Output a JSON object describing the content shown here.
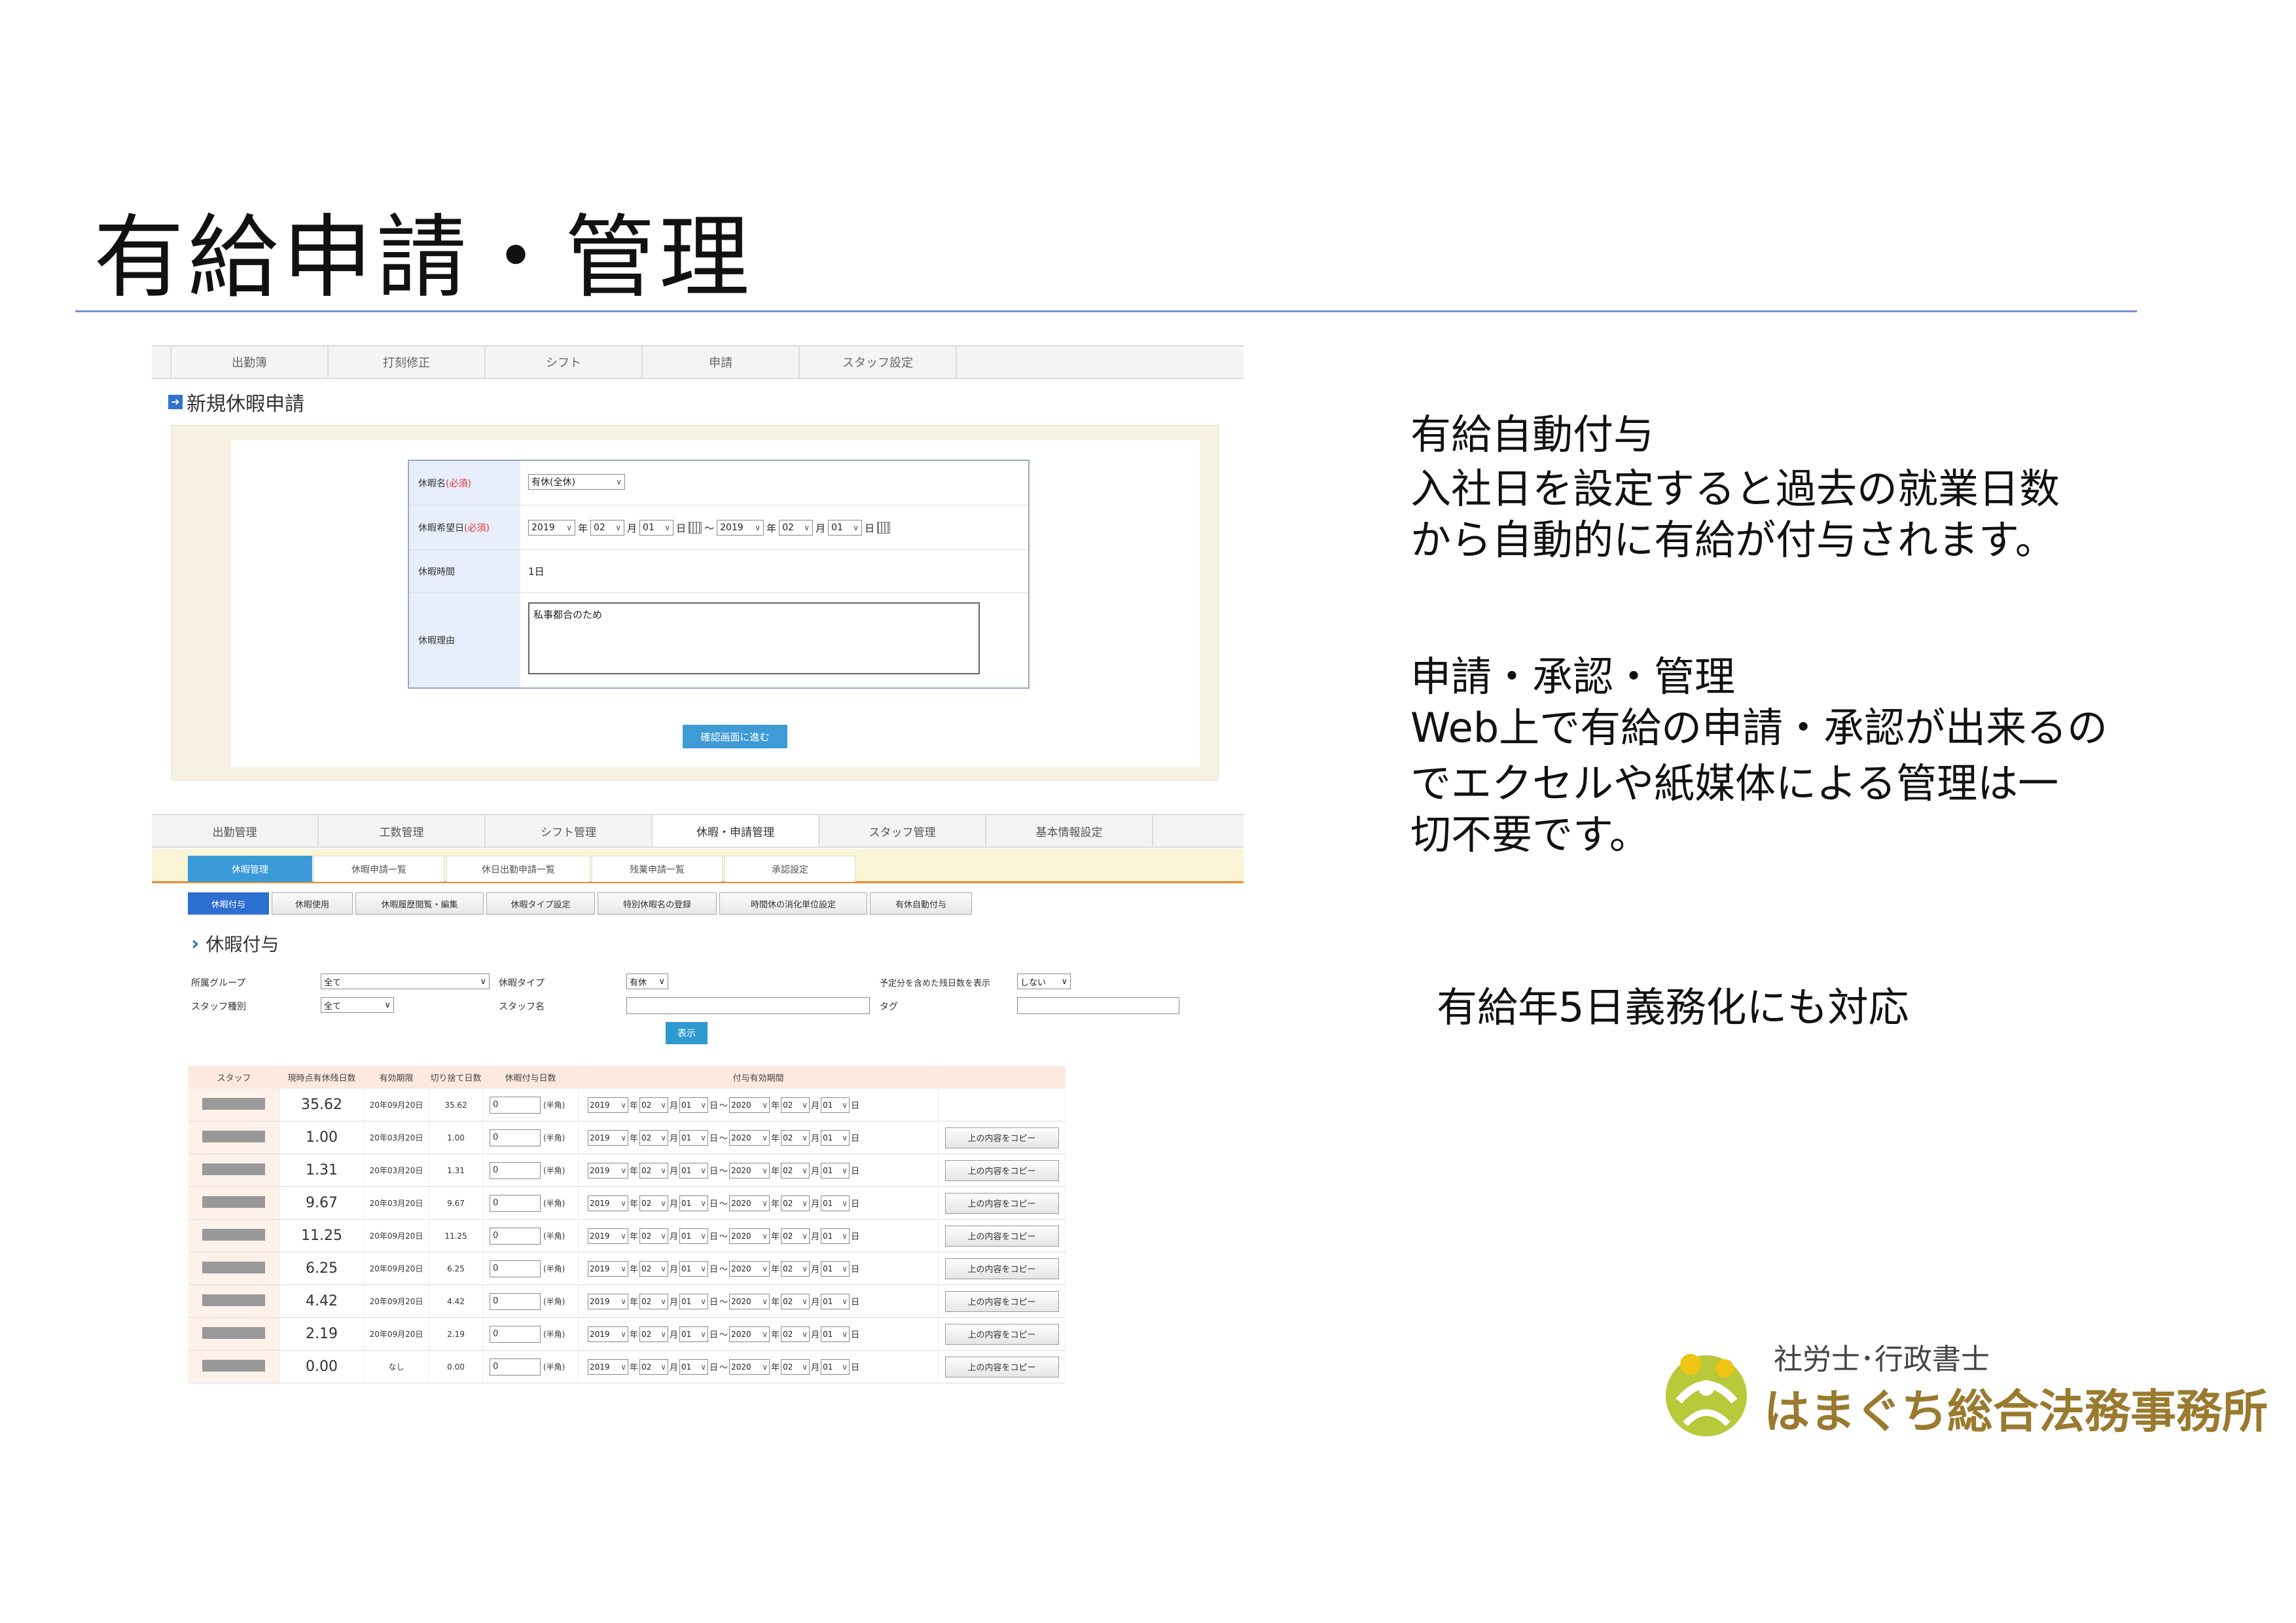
{
  "slide": {
    "title": "有給申請・管理",
    "points": [
      {
        "heading": "有給自動付与",
        "lines": [
          "入社日を設定すると過去の就業日数",
          "から自動的に有給が付与されます。"
        ]
      },
      {
        "heading": "申請・承認・管理",
        "lines": [
          "Web上で有給の申請・承認が出来るの",
          "でエクセルや紙媒体による管理は一",
          "切不要です。"
        ]
      },
      {
        "heading": "有給年5日義務化にも対応",
        "lines": []
      }
    ]
  },
  "logo": {
    "sub": "社労士･行政書士",
    "main": "はまぐち総合法務事務所"
  },
  "shot1": {
    "nav": [
      "出勤簿",
      "打刻修正",
      "シフト",
      "申請",
      "スタッフ設定"
    ],
    "heading": "新規休暇申請",
    "form": {
      "type_label": "休暇名",
      "required": "(必須)",
      "type_value": "有休(全休)",
      "date_label": "休暇希望日",
      "from": {
        "year": "2019",
        "month": "02",
        "day": "01"
      },
      "to": {
        "year": "2019",
        "month": "02",
        "day": "01"
      },
      "u_year": "年",
      "u_month": "月",
      "u_day": "日",
      "tilde": "～",
      "time_label": "休暇時間",
      "time_value": "1日",
      "reason_label": "休暇理由",
      "reason_value": "私事都合のため"
    },
    "confirm_button": "確認画面に進む"
  },
  "shot2": {
    "nav": [
      "出勤管理",
      "工数管理",
      "シフト管理",
      "休暇・申請管理",
      "スタッフ管理",
      "基本情報設定"
    ],
    "subnav": [
      "休暇管理",
      "休暇申請一覧",
      "休日出勤申請一覧",
      "残業申請一覧",
      "承認設定"
    ],
    "tabs": [
      "休暇付与",
      "休暇使用",
      "休暇履歴閲覧・編集",
      "休暇タイプ設定",
      "特別休暇名の登録",
      "時間休の消化単位設定",
      "有休自動付与"
    ],
    "heading": "休暇付与",
    "filters": {
      "group_label": "所属グループ",
      "group_value": "全て",
      "type_label": "休暇タイプ",
      "type_value": "有休",
      "include_label": "予定分を含めた残日数を表示",
      "include_value": "しない",
      "kind_label": "スタッフ種別",
      "kind_value": "全て",
      "name_label": "スタッフ名",
      "tag_label": "タグ"
    },
    "show_button": "表示",
    "table": {
      "headers": [
        "スタッフ",
        "現時点有休残日数",
        "有効期限",
        "切り捨て日数",
        "休暇付与日数",
        "付与有効期間",
        ""
      ],
      "half_note": "(半角)",
      "from": {
        "year": "2019",
        "month": "02",
        "day": "01"
      },
      "to": {
        "year": "2020",
        "month": "02",
        "day": "01"
      },
      "u_year": "年",
      "u_month": "月",
      "u_day": "日",
      "tilde": "～",
      "copy_label": "上の内容をコピー",
      "rows": [
        {
          "remaining": "35.62",
          "expiry": "20年09月20日",
          "cutoff": "35.62",
          "days": "0",
          "copy": false
        },
        {
          "remaining": "1.00",
          "expiry": "20年03月20日",
          "cutoff": "1.00",
          "days": "0",
          "copy": true
        },
        {
          "remaining": "1.31",
          "expiry": "20年03月20日",
          "cutoff": "1.31",
          "days": "0",
          "copy": true
        },
        {
          "remaining": "9.67",
          "expiry": "20年03月20日",
          "cutoff": "9.67",
          "days": "0",
          "copy": true
        },
        {
          "remaining": "11.25",
          "expiry": "20年09月20日",
          "cutoff": "11.25",
          "days": "0",
          "copy": true
        },
        {
          "remaining": "6.25",
          "expiry": "20年09月20日",
          "cutoff": "6.25",
          "days": "0",
          "copy": true
        },
        {
          "remaining": "4.42",
          "expiry": "20年09月20日",
          "cutoff": "4.42",
          "days": "0",
          "copy": true
        },
        {
          "remaining": "2.19",
          "expiry": "20年09月20日",
          "cutoff": "2.19",
          "days": "0",
          "copy": true
        },
        {
          "remaining": "0.00",
          "expiry": "なし",
          "cutoff": "0.00",
          "days": "0",
          "copy": true
        }
      ]
    }
  },
  "colors": {
    "accent": "#3b9ad9",
    "rule": "#6f8fd6",
    "tab_active": "#2d6fd0",
    "orange": "#ea8c2e"
  }
}
